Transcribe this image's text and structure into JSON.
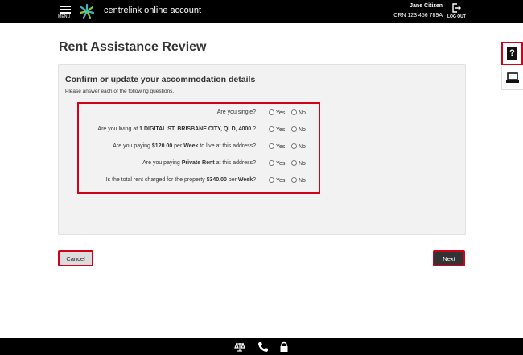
{
  "header": {
    "menu_label": "MENU",
    "app_title": "centrelink online account",
    "user_name": "Jane Citizen",
    "crn": "CRN 123 456 789A",
    "logout_label": "LOG OUT",
    "icons": [
      "menu-icon",
      "centrelink-logo-icon",
      "logout-icon"
    ]
  },
  "page": {
    "title": "Rent Assistance Review"
  },
  "side_tools": {
    "help_glyph": "?",
    "icons": [
      "help-icon",
      "print-icon"
    ]
  },
  "form": {
    "heading": "Confirm or update your accommodation details",
    "subheading": "Please answer each of the following questions.",
    "yes_label": "Yes",
    "no_label": "No",
    "questions": [
      {
        "parts": [
          "Are you single?"
        ]
      },
      {
        "parts": [
          "Are you living at ",
          "1 DIGITAL ST, BRISBANE CITY, QLD, 4000",
          " ?"
        ]
      },
      {
        "parts": [
          "Are you paying ",
          "$120.00",
          " per ",
          "Week",
          " to live at this address?"
        ]
      },
      {
        "parts": [
          "Are you paying ",
          "Private Rent",
          " at this address?"
        ]
      },
      {
        "parts": [
          "Is the total rent charged for the property ",
          "$340.00",
          " per ",
          "Week",
          "?"
        ]
      }
    ]
  },
  "actions": {
    "cancel_label": "Cancel",
    "next_label": "Next"
  },
  "footer": {
    "icons": [
      "scales-icon",
      "phone-icon",
      "lock-icon"
    ]
  },
  "colors": {
    "header_bg": "#000000",
    "highlight_border": "#d0021b",
    "panel_bg": "#f2f2f2",
    "next_bg": "#333333",
    "cancel_bg": "#dcdcdc",
    "logo_teal": "#3fb8c4",
    "logo_green": "#8cc63f"
  }
}
